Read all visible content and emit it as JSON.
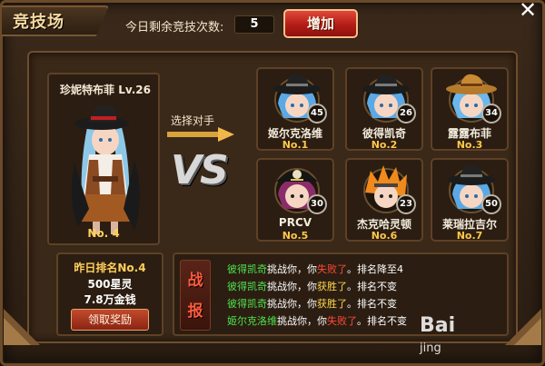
{
  "header": {
    "title": "竞技场",
    "remaining_label": "今日剩余竞技次数:",
    "remaining_count": "5",
    "add_button": "增加"
  },
  "player": {
    "name": "珍妮特布菲 Lv.26",
    "rank": "No. 4"
  },
  "select_label": "选择对手",
  "vs": "VS",
  "opponents": [
    {
      "name": "姬尔克洛维",
      "rank": "No.1",
      "level": "45",
      "hat": "black",
      "hair": "#5aa9e6"
    },
    {
      "name": "彼得凯奇",
      "rank": "No.2",
      "level": "26",
      "hat": "black",
      "hair": "#5aa9e6"
    },
    {
      "name": "露露布菲",
      "rank": "No.3",
      "level": "34",
      "hat": "brown",
      "hair": "#6ab8ef"
    },
    {
      "name": "PRCV",
      "rank": "No.5",
      "level": "30",
      "hat": "pirate",
      "hair": "#8a2c6a"
    },
    {
      "name": "杰克哈灵顿",
      "rank": "No.6",
      "level": "23",
      "hat": "none",
      "hair": "#f08a1c"
    },
    {
      "name": "莱瑞拉吉尔",
      "rank": "No.7",
      "level": "50",
      "hat": "black",
      "hair": "#5aa9e6"
    }
  ],
  "reward": {
    "rank": "昨日排名No.4",
    "stars": "500星灵",
    "gold": "7.8万金钱",
    "claim_button": "领取奖励"
  },
  "report": {
    "badge_line1": "战",
    "badge_line2": "报",
    "lines": [
      {
        "name": "彼得凯奇",
        "mid": "挑战你，你",
        "result": "失败了",
        "result_type": "lose",
        "tail": "。排名降至4"
      },
      {
        "name": "彼得凯奇",
        "mid": "挑战你，你",
        "result": "获胜了",
        "result_type": "win",
        "tail": "。排名不变"
      },
      {
        "name": "彼得凯奇",
        "mid": "挑战你，你",
        "result": "获胜了",
        "result_type": "win",
        "tail": "。排名不变"
      },
      {
        "name": "姬尔克洛维",
        "mid": "挑战你，你",
        "result": "失败了",
        "result_type": "lose",
        "tail": "。排名不变"
      }
    ]
  },
  "watermark": {
    "brand": "Bai",
    "sub": "jing"
  },
  "colors": {
    "panel_bg": "#3a2818",
    "border": "#6f4d2c",
    "gold_text": "#ffcf5a",
    "accent_red": "#b41d16",
    "name_green": "#4fe24f"
  }
}
